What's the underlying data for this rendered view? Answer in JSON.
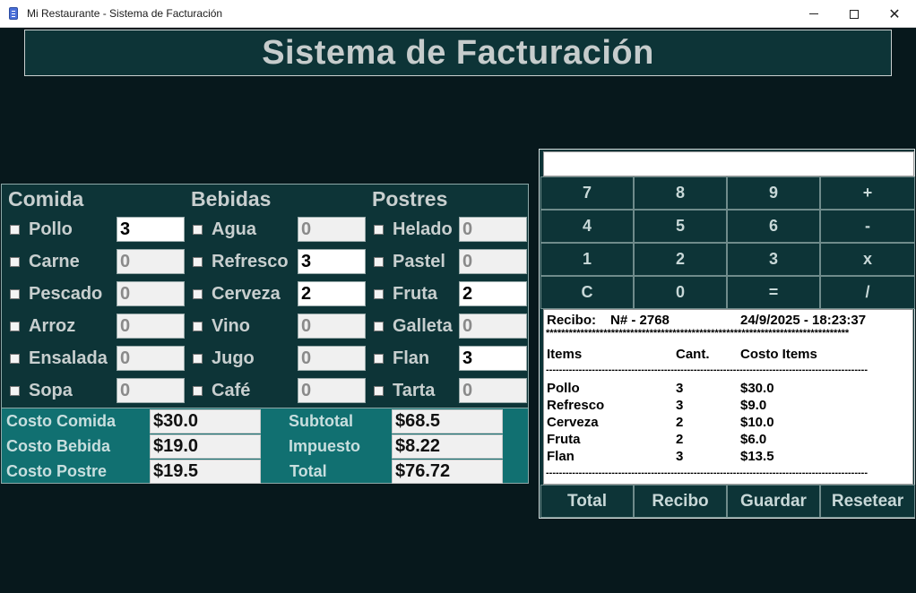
{
  "window": {
    "title": "Mi Restaurante - Sistema de Facturación"
  },
  "header": {
    "title": "Sistema de Facturación"
  },
  "menu": {
    "columns": [
      {
        "heading": "Comida",
        "items": [
          {
            "label": "Pollo",
            "qty": "3",
            "active": true
          },
          {
            "label": "Carne",
            "qty": "0",
            "active": false
          },
          {
            "label": "Pescado",
            "qty": "0",
            "active": false
          },
          {
            "label": "Arroz",
            "qty": "0",
            "active": false
          },
          {
            "label": "Ensalada",
            "qty": "0",
            "active": false
          },
          {
            "label": "Sopa",
            "qty": "0",
            "active": false
          }
        ]
      },
      {
        "heading": "Bebidas",
        "items": [
          {
            "label": "Agua",
            "qty": "0",
            "active": false
          },
          {
            "label": "Refresco",
            "qty": "3",
            "active": true
          },
          {
            "label": "Cerveza",
            "qty": "2",
            "active": true
          },
          {
            "label": "Vino",
            "qty": "0",
            "active": false
          },
          {
            "label": "Jugo",
            "qty": "0",
            "active": false
          },
          {
            "label": "Café",
            "qty": "0",
            "active": false
          }
        ]
      },
      {
        "heading": "Postres",
        "items": [
          {
            "label": "Helado",
            "qty": "0",
            "active": false
          },
          {
            "label": "Pastel",
            "qty": "0",
            "active": false
          },
          {
            "label": "Fruta",
            "qty": "2",
            "active": true
          },
          {
            "label": "Galleta",
            "qty": "0",
            "active": false
          },
          {
            "label": "Flan",
            "qty": "3",
            "active": true
          },
          {
            "label": "Tarta",
            "qty": "0",
            "active": false
          }
        ]
      }
    ]
  },
  "costs": {
    "comida_label": "Costo Comida",
    "comida_value": "$30.0",
    "bebida_label": "Costo Bebida",
    "bebida_value": "$19.0",
    "postre_label": "Costo Postre",
    "postre_value": "$19.5",
    "subtotal_label": "Subtotal",
    "subtotal_value": "$68.5",
    "impuesto_label": "Impuesto",
    "impuesto_value": "$8.22",
    "total_label": "Total",
    "total_value": "$76.72"
  },
  "calculator": {
    "display": "",
    "keys": [
      "7",
      "8",
      "9",
      "+",
      "4",
      "5",
      "6",
      "-",
      "1",
      "2",
      "3",
      "x",
      "C",
      "0",
      "=",
      "/"
    ]
  },
  "receipt": {
    "label": "Recibo:",
    "number": "N# - 2768",
    "datetime": "24/9/2025 - 18:23:37",
    "stars": "*******************************************************************************",
    "col_items": "Items",
    "col_qty": "Cant.",
    "col_cost": "Costo Items",
    "dashes": "--------------------------------------------------------------------------------------------------",
    "lines": [
      {
        "item": "Pollo",
        "qty": "3",
        "cost": "$30.0"
      },
      {
        "item": "Refresco",
        "qty": "3",
        "cost": "$9.0"
      },
      {
        "item": "Cerveza",
        "qty": "2",
        "cost": "$10.0"
      },
      {
        "item": "Fruta",
        "qty": "2",
        "cost": "$6.0"
      },
      {
        "item": "Flan",
        "qty": "3",
        "cost": "$13.5"
      }
    ]
  },
  "actions": {
    "total": "Total",
    "recibo": "Recibo",
    "guardar": "Guardar",
    "resetear": "Resetear"
  }
}
